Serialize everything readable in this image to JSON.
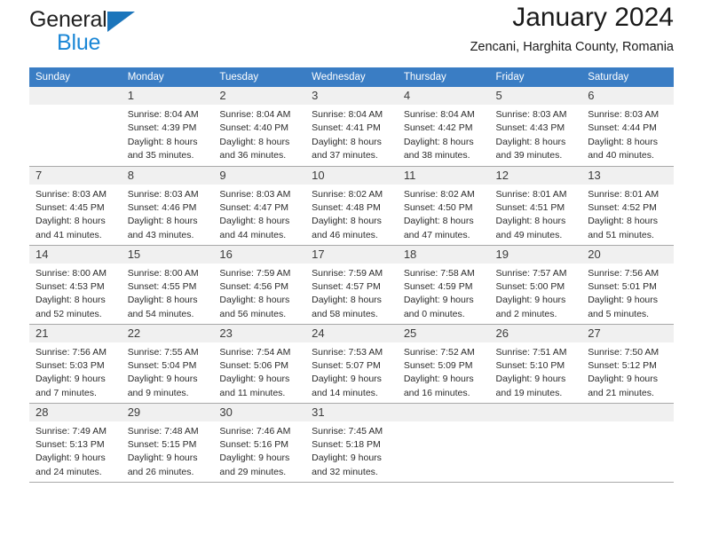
{
  "brand": {
    "line1": "General",
    "line2": "Blue",
    "triangle_color": "#1b75bb"
  },
  "header": {
    "title": "January 2024",
    "subtitle": "Zencani, Harghita County, Romania"
  },
  "theme": {
    "header_row_bg": "#3a7dc4",
    "header_row_text": "#ffffff",
    "daynum_bg": "#f0f0f0",
    "cell_border": "#a9a9a9"
  },
  "weekday_headers": [
    "Sunday",
    "Monday",
    "Tuesday",
    "Wednesday",
    "Thursday",
    "Friday",
    "Saturday"
  ],
  "weeks": [
    [
      {
        "day": "",
        "lines": []
      },
      {
        "day": "1",
        "lines": [
          "Sunrise: 8:04 AM",
          "Sunset: 4:39 PM",
          "Daylight: 8 hours",
          "and 35 minutes."
        ]
      },
      {
        "day": "2",
        "lines": [
          "Sunrise: 8:04 AM",
          "Sunset: 4:40 PM",
          "Daylight: 8 hours",
          "and 36 minutes."
        ]
      },
      {
        "day": "3",
        "lines": [
          "Sunrise: 8:04 AM",
          "Sunset: 4:41 PM",
          "Daylight: 8 hours",
          "and 37 minutes."
        ]
      },
      {
        "day": "4",
        "lines": [
          "Sunrise: 8:04 AM",
          "Sunset: 4:42 PM",
          "Daylight: 8 hours",
          "and 38 minutes."
        ]
      },
      {
        "day": "5",
        "lines": [
          "Sunrise: 8:03 AM",
          "Sunset: 4:43 PM",
          "Daylight: 8 hours",
          "and 39 minutes."
        ]
      },
      {
        "day": "6",
        "lines": [
          "Sunrise: 8:03 AM",
          "Sunset: 4:44 PM",
          "Daylight: 8 hours",
          "and 40 minutes."
        ]
      }
    ],
    [
      {
        "day": "7",
        "lines": [
          "Sunrise: 8:03 AM",
          "Sunset: 4:45 PM",
          "Daylight: 8 hours",
          "and 41 minutes."
        ]
      },
      {
        "day": "8",
        "lines": [
          "Sunrise: 8:03 AM",
          "Sunset: 4:46 PM",
          "Daylight: 8 hours",
          "and 43 minutes."
        ]
      },
      {
        "day": "9",
        "lines": [
          "Sunrise: 8:03 AM",
          "Sunset: 4:47 PM",
          "Daylight: 8 hours",
          "and 44 minutes."
        ]
      },
      {
        "day": "10",
        "lines": [
          "Sunrise: 8:02 AM",
          "Sunset: 4:48 PM",
          "Daylight: 8 hours",
          "and 46 minutes."
        ]
      },
      {
        "day": "11",
        "lines": [
          "Sunrise: 8:02 AM",
          "Sunset: 4:50 PM",
          "Daylight: 8 hours",
          "and 47 minutes."
        ]
      },
      {
        "day": "12",
        "lines": [
          "Sunrise: 8:01 AM",
          "Sunset: 4:51 PM",
          "Daylight: 8 hours",
          "and 49 minutes."
        ]
      },
      {
        "day": "13",
        "lines": [
          "Sunrise: 8:01 AM",
          "Sunset: 4:52 PM",
          "Daylight: 8 hours",
          "and 51 minutes."
        ]
      }
    ],
    [
      {
        "day": "14",
        "lines": [
          "Sunrise: 8:00 AM",
          "Sunset: 4:53 PM",
          "Daylight: 8 hours",
          "and 52 minutes."
        ]
      },
      {
        "day": "15",
        "lines": [
          "Sunrise: 8:00 AM",
          "Sunset: 4:55 PM",
          "Daylight: 8 hours",
          "and 54 minutes."
        ]
      },
      {
        "day": "16",
        "lines": [
          "Sunrise: 7:59 AM",
          "Sunset: 4:56 PM",
          "Daylight: 8 hours",
          "and 56 minutes."
        ]
      },
      {
        "day": "17",
        "lines": [
          "Sunrise: 7:59 AM",
          "Sunset: 4:57 PM",
          "Daylight: 8 hours",
          "and 58 minutes."
        ]
      },
      {
        "day": "18",
        "lines": [
          "Sunrise: 7:58 AM",
          "Sunset: 4:59 PM",
          "Daylight: 9 hours",
          "and 0 minutes."
        ]
      },
      {
        "day": "19",
        "lines": [
          "Sunrise: 7:57 AM",
          "Sunset: 5:00 PM",
          "Daylight: 9 hours",
          "and 2 minutes."
        ]
      },
      {
        "day": "20",
        "lines": [
          "Sunrise: 7:56 AM",
          "Sunset: 5:01 PM",
          "Daylight: 9 hours",
          "and 5 minutes."
        ]
      }
    ],
    [
      {
        "day": "21",
        "lines": [
          "Sunrise: 7:56 AM",
          "Sunset: 5:03 PM",
          "Daylight: 9 hours",
          "and 7 minutes."
        ]
      },
      {
        "day": "22",
        "lines": [
          "Sunrise: 7:55 AM",
          "Sunset: 5:04 PM",
          "Daylight: 9 hours",
          "and 9 minutes."
        ]
      },
      {
        "day": "23",
        "lines": [
          "Sunrise: 7:54 AM",
          "Sunset: 5:06 PM",
          "Daylight: 9 hours",
          "and 11 minutes."
        ]
      },
      {
        "day": "24",
        "lines": [
          "Sunrise: 7:53 AM",
          "Sunset: 5:07 PM",
          "Daylight: 9 hours",
          "and 14 minutes."
        ]
      },
      {
        "day": "25",
        "lines": [
          "Sunrise: 7:52 AM",
          "Sunset: 5:09 PM",
          "Daylight: 9 hours",
          "and 16 minutes."
        ]
      },
      {
        "day": "26",
        "lines": [
          "Sunrise: 7:51 AM",
          "Sunset: 5:10 PM",
          "Daylight: 9 hours",
          "and 19 minutes."
        ]
      },
      {
        "day": "27",
        "lines": [
          "Sunrise: 7:50 AM",
          "Sunset: 5:12 PM",
          "Daylight: 9 hours",
          "and 21 minutes."
        ]
      }
    ],
    [
      {
        "day": "28",
        "lines": [
          "Sunrise: 7:49 AM",
          "Sunset: 5:13 PM",
          "Daylight: 9 hours",
          "and 24 minutes."
        ]
      },
      {
        "day": "29",
        "lines": [
          "Sunrise: 7:48 AM",
          "Sunset: 5:15 PM",
          "Daylight: 9 hours",
          "and 26 minutes."
        ]
      },
      {
        "day": "30",
        "lines": [
          "Sunrise: 7:46 AM",
          "Sunset: 5:16 PM",
          "Daylight: 9 hours",
          "and 29 minutes."
        ]
      },
      {
        "day": "31",
        "lines": [
          "Sunrise: 7:45 AM",
          "Sunset: 5:18 PM",
          "Daylight: 9 hours",
          "and 32 minutes."
        ]
      },
      {
        "day": "",
        "lines": []
      },
      {
        "day": "",
        "lines": []
      },
      {
        "day": "",
        "lines": []
      }
    ]
  ]
}
